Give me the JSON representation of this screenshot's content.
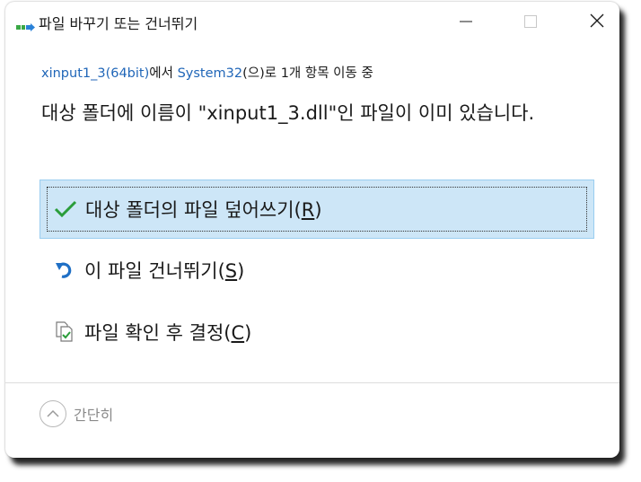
{
  "window": {
    "title": "파일 바꾸기 또는 건너뛰기",
    "minimize_icon": "minimize-icon",
    "maximize_icon": "maximize-icon",
    "close_icon": "close-icon"
  },
  "source_line": {
    "source": "xinput1_3(64bit)",
    "mid1": "에서 ",
    "destination": "System32",
    "rest": "(으)로 1개 항목 이동 중"
  },
  "message": "대상 폴더에 이름이 \"xinput1_3.dll\"인 파일이 이미 있습니다.",
  "options": [
    {
      "label": "대상 폴더의 파일 덮어쓰기(",
      "key": "R",
      "close": ")",
      "icon": "checkmark-icon",
      "selected": true
    },
    {
      "label": "이 파일 건너뛰기(",
      "key": "S",
      "close": ")",
      "icon": "undo-arrow-icon",
      "selected": false
    },
    {
      "label": "파일 확인 후 결정(",
      "key": "C",
      "close": ")",
      "icon": "compare-files-icon",
      "selected": false
    }
  ],
  "collapse": {
    "label": "간단히",
    "icon": "chevron-up-icon"
  },
  "colors": {
    "link": "#2066b8",
    "selection_bg": "#cde6f7",
    "selection_border": "#99cdf0",
    "check_green": "#2a9d3a",
    "undo_blue": "#1f6fc5"
  }
}
